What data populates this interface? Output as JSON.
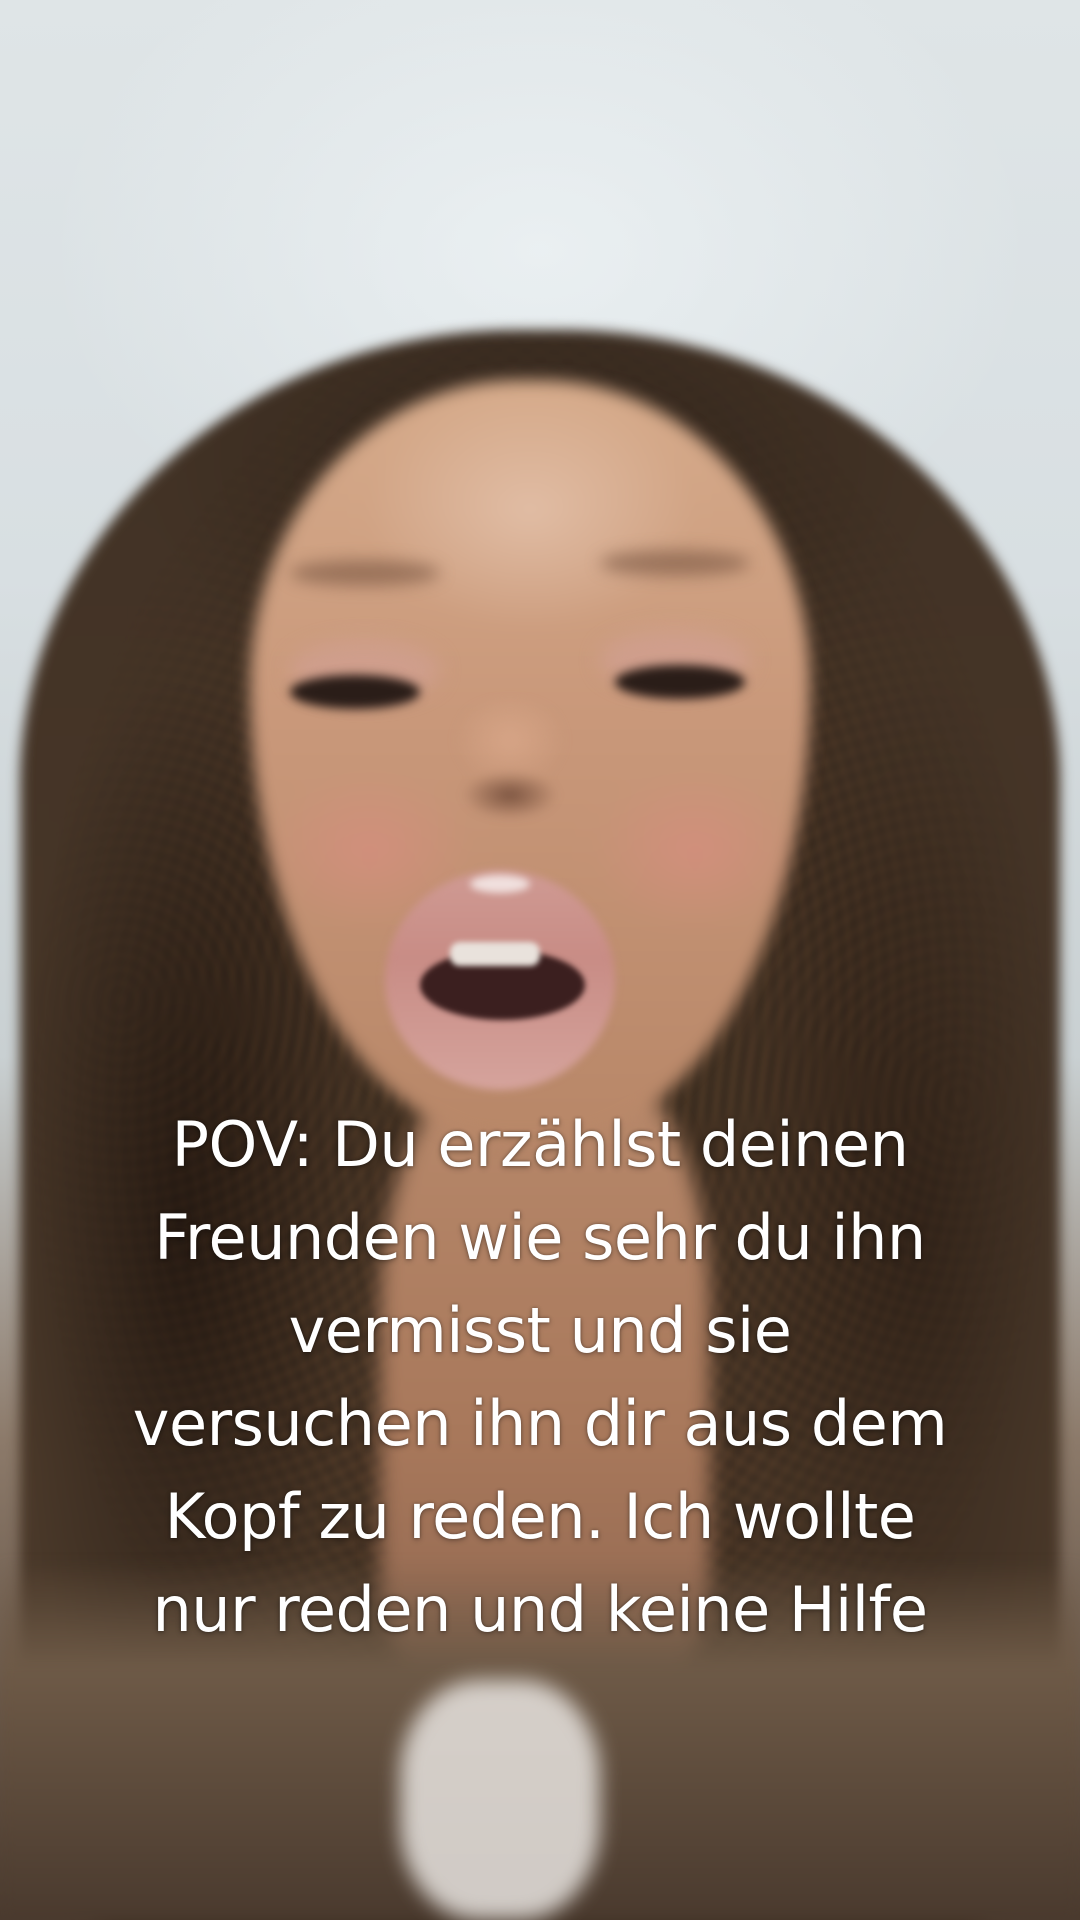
{
  "video": {
    "caption_lines": [
      "POV: Du erzählst deinen",
      "Freunden wie sehr du ihn",
      "vermisst und sie",
      "versuchen ihn dir aus dem",
      "Kopf zu reden. Ich wollte",
      "nur reden und keine Hilfe"
    ],
    "caption_color": "#ffffff"
  }
}
